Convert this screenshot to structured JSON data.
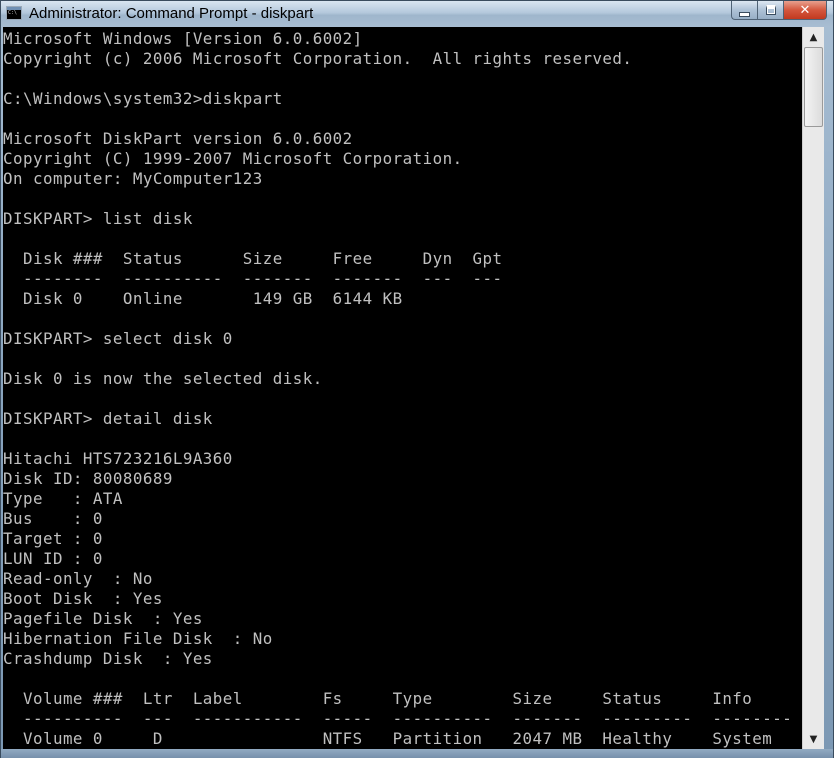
{
  "window": {
    "title": "Administrator: Command Prompt - diskpart",
    "close_label": "✕"
  },
  "console": {
    "lines": [
      "Microsoft Windows [Version 6.0.6002]",
      "Copyright (c) 2006 Microsoft Corporation.  All rights reserved.",
      "",
      "C:\\Windows\\system32>diskpart",
      "",
      "Microsoft DiskPart version 6.0.6002",
      "Copyright (C) 1999-2007 Microsoft Corporation.",
      "On computer: MyComputer123",
      "",
      "DISKPART> list disk",
      "",
      "  Disk ###  Status      Size     Free     Dyn  Gpt",
      "  --------  ----------  -------  -------  ---  ---",
      "  Disk 0    Online       149 GB  6144 KB",
      "",
      "DISKPART> select disk 0",
      "",
      "Disk 0 is now the selected disk.",
      "",
      "DISKPART> detail disk",
      "",
      "Hitachi HTS723216L9A360",
      "Disk ID: 80080689",
      "Type   : ATA",
      "Bus    : 0",
      "Target : 0",
      "LUN ID : 0",
      "Read-only  : No",
      "Boot Disk  : Yes",
      "Pagefile Disk  : Yes",
      "Hibernation File Disk  : No",
      "Crashdump Disk  : Yes",
      "",
      "  Volume ###  Ltr  Label        Fs     Type        Size     Status     Info",
      "  ----------  ---  -----------  -----  ----------  -------  ---------  --------",
      "  Volume 0     D                NTFS   Partition   2047 MB  Healthy    System"
    ]
  },
  "scrollbar": {
    "up_arrow": "▲",
    "down_arrow": "▼"
  }
}
